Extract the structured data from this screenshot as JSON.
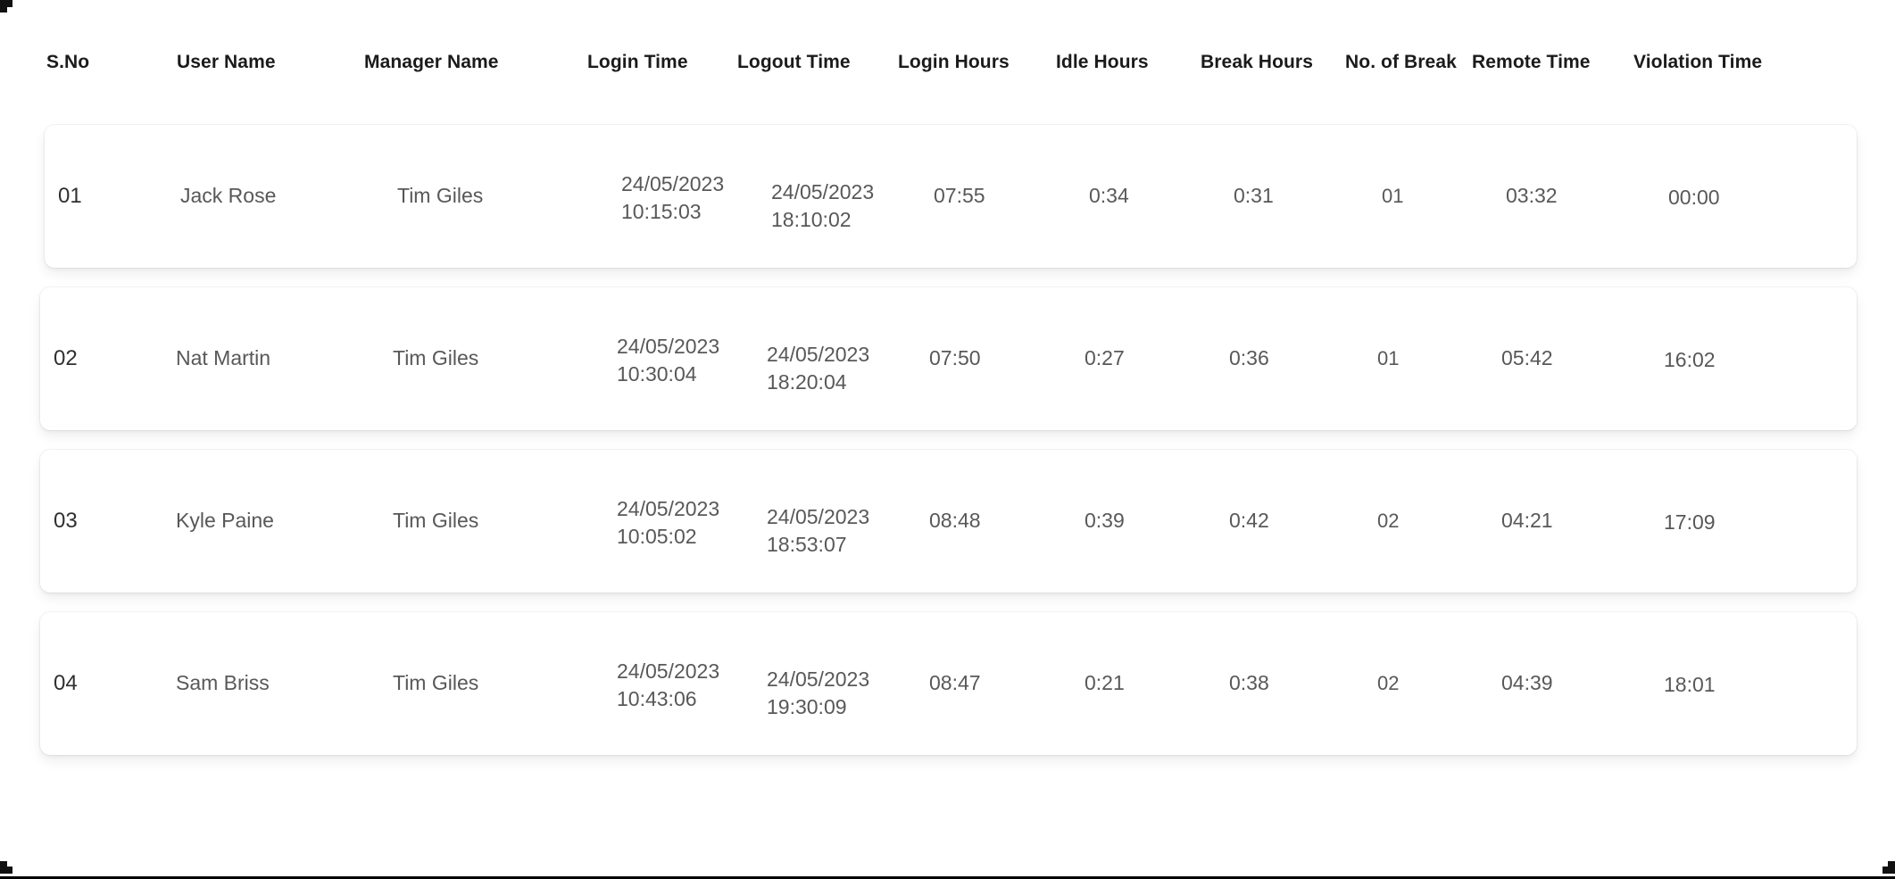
{
  "table": {
    "columns": [
      {
        "key": "sno",
        "label": "S.No"
      },
      {
        "key": "user",
        "label": "User Name"
      },
      {
        "key": "manager",
        "label": "Manager Name"
      },
      {
        "key": "login",
        "label": "Login Time"
      },
      {
        "key": "logout",
        "label": "Logout Time"
      },
      {
        "key": "lhours",
        "label": "Login Hours"
      },
      {
        "key": "ihours",
        "label": "Idle Hours"
      },
      {
        "key": "bhours",
        "label": "Break Hours"
      },
      {
        "key": "nbreak",
        "label": "No. of Break"
      },
      {
        "key": "remote",
        "label": "Remote Time"
      },
      {
        "key": "violation",
        "label": "Violation Time"
      }
    ],
    "rows": [
      {
        "sno": "01",
        "user": "Jack Rose",
        "manager": "Tim Giles",
        "login": "24/05/2023\n10:15:03",
        "logout": "24/05/2023\n18:10:02",
        "lhours": "07:55",
        "ihours": "0:34",
        "bhours": "0:31",
        "nbreak": "01",
        "remote": "03:32",
        "violation": "00:00"
      },
      {
        "sno": "02",
        "user": "Nat Martin",
        "manager": "Tim Giles",
        "login": "24/05/2023\n10:30:04",
        "logout": "24/05/2023\n18:20:04",
        "lhours": "07:50",
        "ihours": "0:27",
        "bhours": "0:36",
        "nbreak": "01",
        "remote": "05:42",
        "violation": "16:02"
      },
      {
        "sno": "03",
        "user": "Kyle Paine",
        "manager": "Tim Giles",
        "login": "24/05/2023\n10:05:02",
        "logout": "24/05/2023\n18:53:07",
        "lhours": "08:48",
        "ihours": "0:39",
        "bhours": "0:42",
        "nbreak": "02",
        "remote": "04:21",
        "violation": "17:09"
      },
      {
        "sno": "04",
        "user": "Sam Briss",
        "manager": "Tim Giles",
        "login": "24/05/2023\n10:43:06",
        "logout": "24/05/2023\n19:30:09",
        "lhours": "08:47",
        "ihours": "0:21",
        "bhours": "0:38",
        "nbreak": "02",
        "remote": "04:39",
        "violation": "18:01"
      }
    ]
  },
  "colors": {
    "page_background": "#ffffff",
    "card_background": "#ffffff",
    "header_text": "#1b1b1b",
    "cell_text": "#585858",
    "sno_text": "#2f2f2f"
  }
}
